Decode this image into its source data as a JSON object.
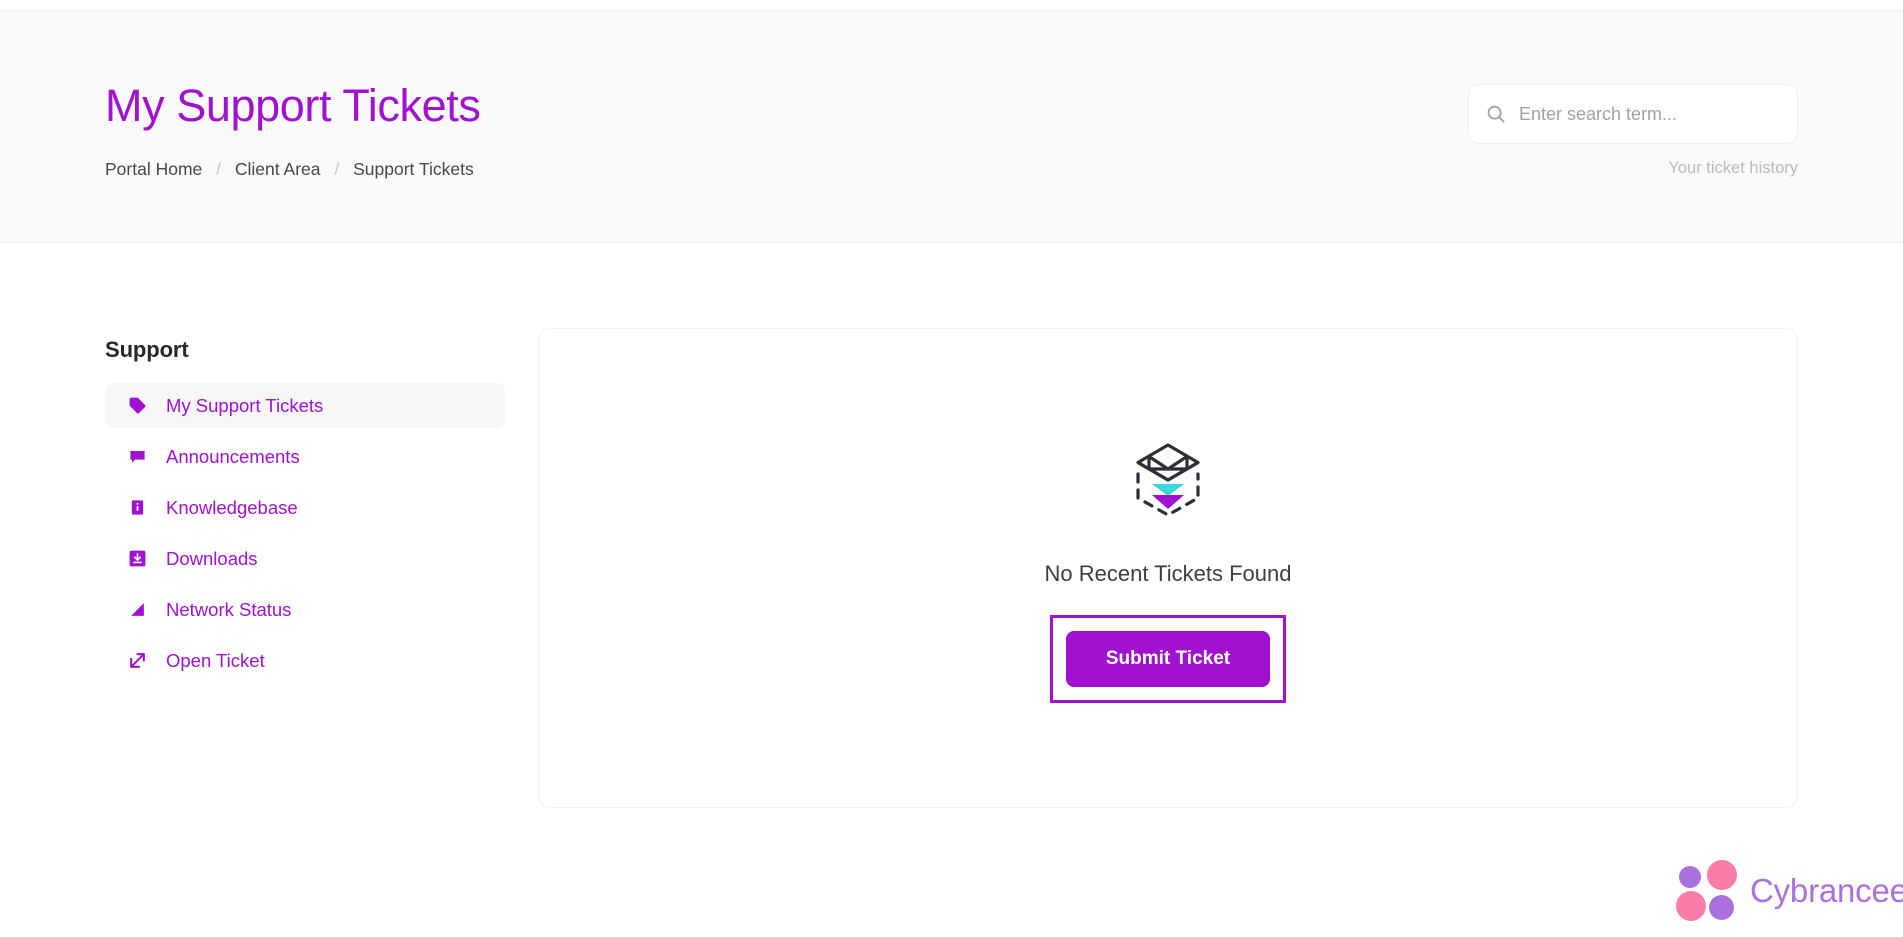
{
  "header": {
    "title": "My Support Tickets",
    "breadcrumb": [
      {
        "label": "Portal Home"
      },
      {
        "label": "Client Area"
      },
      {
        "label": "Support Tickets"
      }
    ],
    "breadcrumb_separator": "/",
    "search": {
      "placeholder": "Enter search term...",
      "value": "",
      "icon": "search-icon"
    },
    "helper_text": "Your ticket history"
  },
  "sidebar": {
    "heading": "Support",
    "items": [
      {
        "label": "My Support Tickets",
        "icon": "tag-icon",
        "active": true
      },
      {
        "label": "Announcements",
        "icon": "megaphone-icon",
        "active": false
      },
      {
        "label": "Knowledgebase",
        "icon": "book-icon",
        "active": false
      },
      {
        "label": "Downloads",
        "icon": "download-icon",
        "active": false
      },
      {
        "label": "Network Status",
        "icon": "signal-icon",
        "active": false
      },
      {
        "label": "Open Ticket",
        "icon": "external-link-icon",
        "active": false
      }
    ]
  },
  "main": {
    "empty_state": {
      "illustration": "empty-inbox-icon",
      "message": "No Recent Tickets Found",
      "submit_label": "Submit Ticket"
    }
  },
  "footer": {
    "brand_name": "Cybrancee",
    "logo": "cybrancee-dots-logo"
  },
  "colors": {
    "accent_purple": "#a012d0",
    "brand_purple": "#a971e0",
    "brand_pink": "#f97ca9",
    "illustration_cyan": "#3ad6de",
    "illustration_purple": "#a012d0",
    "text_dark": "#3a4046",
    "text_muted": "#b7bbc0",
    "header_bg": "#fafafb"
  }
}
